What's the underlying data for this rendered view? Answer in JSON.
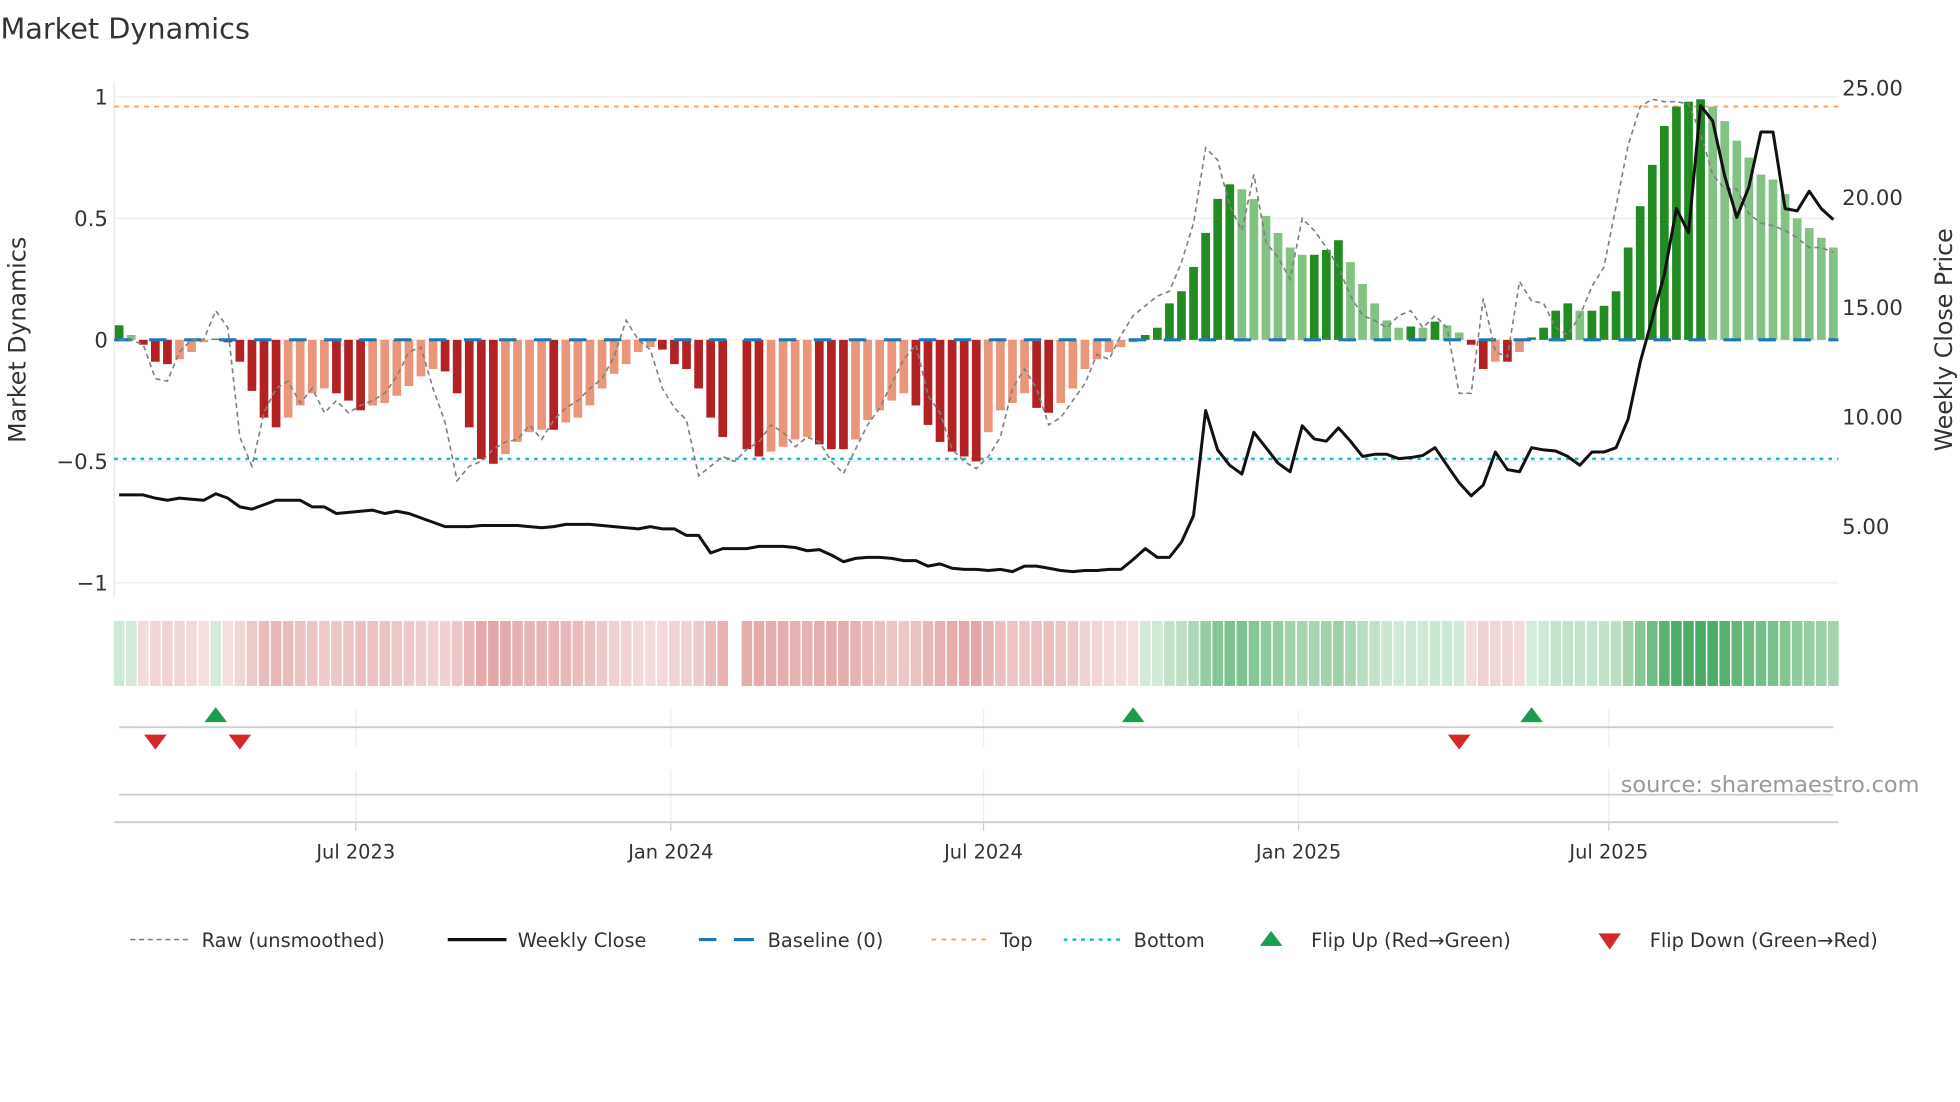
{
  "chart_data": {
    "type": "bar",
    "title": "Market Dynamics",
    "ylabel": "Market Dynamics",
    "y2label": "Weekly Close Price",
    "ylim": [
      -1,
      1
    ],
    "y2lim": [
      2.3,
      25.4
    ],
    "yticks": [
      "1",
      "0.5",
      "0",
      "−0.5",
      "−1"
    ],
    "ytick_values": [
      1,
      0.5,
      0,
      -0.5,
      -1
    ],
    "y2ticks": [
      "25.00",
      "20.00",
      "15.00",
      "10.00",
      "5.00"
    ],
    "y2tick_values": [
      25,
      20,
      15,
      10,
      5
    ],
    "top_level": 0.96,
    "bottom_level": -0.49,
    "baseline": 0,
    "xticks": [
      {
        "label": "Jul 2023",
        "week": 19.6
      },
      {
        "label": "Jan 2024",
        "week": 45.7
      },
      {
        "label": "Jul 2024",
        "week": 71.6
      },
      {
        "label": "Jan 2025",
        "week": 97.7
      },
      {
        "label": "Jul 2025",
        "week": 123.4
      }
    ],
    "smoothed": [
      0.06,
      0.02,
      -0.02,
      -0.09,
      -0.1,
      -0.08,
      -0.05,
      -0.01,
      0.005,
      -0.01,
      -0.09,
      -0.21,
      -0.32,
      -0.36,
      -0.32,
      -0.27,
      -0.22,
      -0.2,
      -0.22,
      -0.25,
      -0.29,
      -0.27,
      -0.26,
      -0.23,
      -0.19,
      -0.15,
      -0.12,
      -0.13,
      -0.22,
      -0.36,
      -0.49,
      -0.51,
      -0.47,
      -0.42,
      -0.38,
      -0.37,
      -0.37,
      -0.34,
      -0.32,
      -0.27,
      -0.2,
      -0.14,
      -0.1,
      -0.05,
      -0.03,
      -0.04,
      -0.1,
      -0.12,
      -0.2,
      -0.32,
      -0.4,
      null,
      -0.45,
      -0.48,
      -0.46,
      -0.44,
      -0.41,
      -0.4,
      -0.43,
      -0.45,
      -0.45,
      -0.41,
      -0.33,
      -0.29,
      -0.25,
      -0.22,
      -0.27,
      -0.35,
      -0.42,
      -0.46,
      -0.48,
      -0.5,
      -0.38,
      -0.29,
      -0.26,
      -0.22,
      -0.28,
      -0.3,
      -0.26,
      -0.2,
      -0.12,
      -0.08,
      -0.05,
      -0.03,
      -0.01,
      0.02,
      0.05,
      0.15,
      0.2,
      0.3,
      0.44,
      0.58,
      0.64,
      0.62,
      0.58,
      0.51,
      0.44,
      0.38,
      0.35,
      0.35,
      0.37,
      0.41,
      0.32,
      0.23,
      0.15,
      0.08,
      0.05,
      0.055,
      0.05,
      0.075,
      0.06,
      0.03,
      -0.02,
      -0.12,
      -0.09,
      -0.09,
      -0.05,
      0.01,
      0.05,
      0.12,
      0.15,
      0.12,
      0.12,
      0.14,
      0.2,
      0.38,
      0.55,
      0.72,
      0.88,
      0.96,
      0.98,
      0.99,
      0.96,
      0.9,
      0.82,
      0.75,
      0.68,
      0.66,
      0.6,
      0.5,
      0.46,
      0.42,
      0.38
    ],
    "raw": [
      0.0,
      0.0,
      -0.02,
      -0.16,
      -0.17,
      -0.05,
      0.0,
      0.0,
      0.12,
      0.05,
      -0.4,
      -0.52,
      -0.3,
      -0.2,
      -0.17,
      -0.26,
      -0.2,
      -0.3,
      -0.25,
      -0.3,
      -0.27,
      -0.25,
      -0.22,
      -0.15,
      -0.05,
      -0.03,
      -0.2,
      -0.34,
      -0.58,
      -0.52,
      -0.5,
      -0.45,
      -0.42,
      -0.41,
      -0.35,
      -0.41,
      -0.33,
      -0.28,
      -0.25,
      -0.2,
      -0.16,
      -0.07,
      0.08,
      0.0,
      -0.04,
      -0.2,
      -0.28,
      -0.33,
      -0.56,
      -0.52,
      -0.48,
      -0.5,
      -0.45,
      -0.42,
      -0.35,
      -0.38,
      -0.44,
      -0.4,
      -0.42,
      -0.5,
      -0.55,
      -0.45,
      -0.35,
      -0.28,
      -0.18,
      -0.08,
      -0.02,
      -0.23,
      -0.3,
      -0.45,
      -0.5,
      -0.53,
      -0.48,
      -0.4,
      -0.2,
      -0.12,
      -0.2,
      -0.35,
      -0.32,
      -0.25,
      -0.18,
      -0.06,
      -0.08,
      0.02,
      0.1,
      0.14,
      0.18,
      0.2,
      0.32,
      0.48,
      0.79,
      0.74,
      0.55,
      0.45,
      0.68,
      0.4,
      0.34,
      0.25,
      0.5,
      0.45,
      0.38,
      0.3,
      0.18,
      0.1,
      0.08,
      0.05,
      0.1,
      0.12,
      0.05,
      0.1,
      0.05,
      -0.22,
      -0.22,
      0.17,
      -0.05,
      -0.07,
      0.24,
      0.16,
      0.15,
      0.05,
      0.02,
      0.1,
      0.22,
      0.3,
      0.55,
      0.8,
      0.96,
      0.99,
      0.98,
      0.98,
      0.97,
      0.85,
      0.68,
      0.62,
      0.62,
      0.52,
      0.48,
      0.47,
      0.45,
      0.42,
      0.38,
      0.38,
      0.36
    ],
    "weekly_close": [
      6.45,
      6.45,
      6.45,
      6.3,
      6.2,
      6.3,
      6.25,
      6.2,
      6.5,
      6.3,
      5.9,
      5.8,
      6.0,
      6.2,
      6.2,
      6.2,
      5.9,
      5.9,
      5.6,
      5.65,
      5.7,
      5.75,
      5.6,
      5.7,
      5.6,
      5.4,
      5.2,
      5.0,
      5.0,
      5.0,
      5.05,
      5.05,
      5.05,
      5.05,
      5.0,
      4.95,
      5.0,
      5.1,
      5.1,
      5.1,
      5.05,
      5.0,
      4.95,
      4.9,
      5.0,
      4.9,
      4.9,
      4.6,
      4.6,
      3.8,
      4.0,
      4.0,
      4.0,
      4.1,
      4.1,
      4.1,
      4.05,
      3.9,
      3.95,
      3.7,
      3.4,
      3.55,
      3.6,
      3.6,
      3.55,
      3.45,
      3.45,
      3.2,
      3.3,
      3.1,
      3.05,
      3.05,
      3.0,
      3.05,
      2.95,
      3.2,
      3.2,
      3.1,
      3.0,
      2.95,
      3.0,
      3.0,
      3.05,
      3.05,
      3.5,
      4.0,
      3.6,
      3.6,
      4.3,
      5.5,
      10.3,
      8.5,
      7.8,
      7.4,
      9.3,
      8.6,
      7.9,
      7.5,
      9.6,
      9.0,
      8.9,
      9.5,
      8.9,
      8.2,
      8.3,
      8.3,
      8.1,
      8.15,
      8.25,
      8.6,
      7.8,
      7.0,
      6.4,
      6.9,
      8.4,
      7.6,
      7.5,
      8.6,
      8.5,
      8.45,
      8.2,
      7.8,
      8.4,
      8.4,
      8.6,
      9.9,
      12.5,
      14.5,
      16.5,
      19.5,
      18.4,
      24.2,
      23.5,
      21.0,
      19.1,
      20.5,
      23.0,
      23.0,
      19.5,
      19.4,
      20.3,
      19.5,
      19.0
    ],
    "flip_up_weeks": [
      8,
      84,
      117
    ],
    "flip_down_weeks": [
      3,
      10,
      111
    ],
    "legend": {
      "raw": "Raw (unsmoothed)",
      "close": "Weekly Close",
      "baseline": "Baseline (0)",
      "top": "Top",
      "bottom": "Bottom",
      "flip_up": "Flip Up (Red→Green)",
      "flip_down": "Flip Down (Green→Red)"
    },
    "legend_placement": "bottom",
    "source": "source: sharemaestro.com",
    "colors": {
      "pos_rising": "#228b22",
      "pos_falling": "#82c282",
      "neg_falling": "#b22222",
      "neg_rising": "#e9967a",
      "top": "#f4a460",
      "bottom": "#17becf",
      "baseline": "#1f77b4",
      "raw": "#808080",
      "close": "#111111",
      "flip_up": "#1a9e4b",
      "flip_down": "#d62728"
    }
  }
}
